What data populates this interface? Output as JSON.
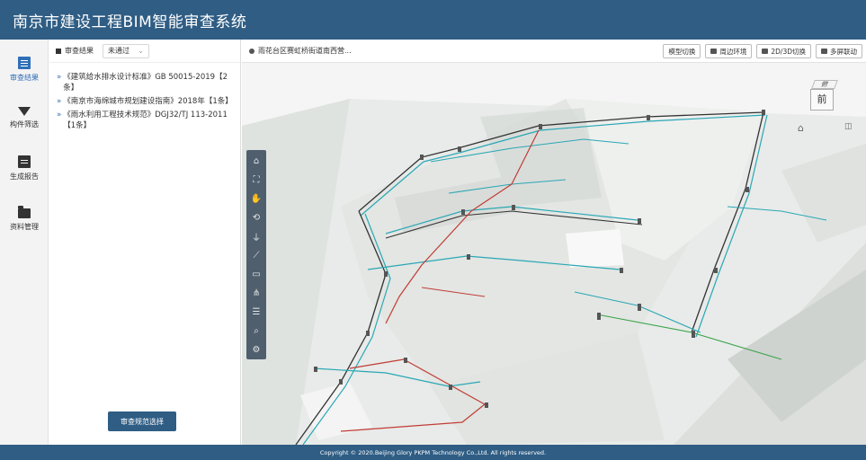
{
  "header": {
    "title": "南京市建设工程BIM智能审查系统"
  },
  "nav": {
    "items": [
      {
        "label": "审查结果",
        "icon": "document-list-icon",
        "active": true
      },
      {
        "label": "构件筛选",
        "icon": "filter-icon",
        "active": false
      },
      {
        "label": "生成报告",
        "icon": "file-report-icon",
        "active": false
      },
      {
        "label": "资料管理",
        "icon": "folder-icon",
        "active": false
      }
    ]
  },
  "panel": {
    "header_label": "审查结果",
    "filter_value": "未通过",
    "regulations": [
      {
        "text": "《建筑给水排水设计标准》GB 50015-2019【2条】"
      },
      {
        "text": "《南京市海绵城市规划建设指南》2018年【1条】"
      },
      {
        "text": "《雨水利用工程技术规范》DGJ32/TJ 113-2011【1条】"
      }
    ],
    "select_button": "审查规范选择"
  },
  "viewer": {
    "location": "雨花台区赛虹桥街道南西营...",
    "buttons": [
      {
        "label": "模型切换",
        "icon": "cube-icon"
      },
      {
        "label": "周边环境",
        "icon": "monitor-icon"
      },
      {
        "label": "2D/3D切换",
        "icon": "toggle-2d3d-icon"
      },
      {
        "label": "多屏联动",
        "icon": "multiscreen-icon"
      }
    ],
    "tools": [
      "home-icon",
      "fit-view-icon",
      "pan-hand-icon",
      "orbit-icon",
      "microphone-icon",
      "measure-icon",
      "section-icon",
      "tree-icon",
      "layers-icon",
      "search-icon",
      "settings-icon"
    ],
    "viewcube": {
      "top": "俯",
      "front": "前"
    }
  },
  "colors": {
    "header": "#2f5d84",
    "accent": "#2f6fb7",
    "pipe_cyan": "#2aa7b5",
    "pipe_red": "#c23b35",
    "pipe_dark": "#333333",
    "pipe_green": "#3aa34a"
  },
  "footer": {
    "copyright": "Copyright © 2020.Beijing Glory PKPM Technology Co.,Ltd. All rights reserved."
  }
}
